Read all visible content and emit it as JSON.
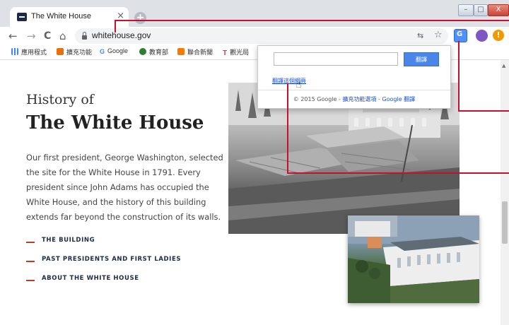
{
  "browser": {
    "tab": {
      "title": "The White House",
      "close_glyph": "×"
    },
    "new_tab_glyph": "+",
    "window_controls": {
      "minimize": "–",
      "maximize": "□",
      "close": "X"
    },
    "nav": {
      "back": "←",
      "forward": "→",
      "reload": "C",
      "home": "⌂"
    },
    "url": "whitehouse.gov",
    "toolbar_icons": [
      "translate-page-icon",
      "star-icon",
      "google-translate-extension-icon",
      "profile-avatar-icon",
      "update-icon"
    ],
    "star_glyph": "☆",
    "update_glyph": "!"
  },
  "bookmarks": [
    {
      "label": "應用程式",
      "icon": "apps-grid-icon",
      "color": "#4285f4"
    },
    {
      "label": "擴充功能",
      "icon": "extensions-icon",
      "color": "#e8710a"
    },
    {
      "label": "Google",
      "icon": "google-icon",
      "color": "#4285f4"
    },
    {
      "label": "教育部",
      "icon": "moe-icon",
      "color": "#2e7d32"
    },
    {
      "label": "聯合新聞",
      "icon": "udn-icon",
      "color": "#f57c00"
    },
    {
      "label": "觀光局",
      "icon": "tourism-icon",
      "color": "#e53935"
    }
  ],
  "translate_popup": {
    "input_value": "",
    "button_label": "翻譯",
    "link_label": "翻譯這個網頁",
    "footer_prefix": "© 2015 Google - ",
    "footer_link1": "擴充功能選項",
    "footer_sep": " - ",
    "footer_link2": "Google 翻譯"
  },
  "page": {
    "heading_small": "History of",
    "heading_large": "The White House",
    "intro": "Our first president, George Washington, selected the site for the White House in 1791. Every president since John Adams has occupied the White House, and the history of this building extends far beyond the construction of its walls.",
    "links": [
      "THE BUILDING",
      "PAST PRESIDENTS AND FIRST LADIES",
      "ABOUT THE WHITE HOUSE"
    ]
  },
  "colors": {
    "accent": "#c0392b",
    "callout": "#c8102e",
    "translate_blue": "#4a86e8"
  }
}
